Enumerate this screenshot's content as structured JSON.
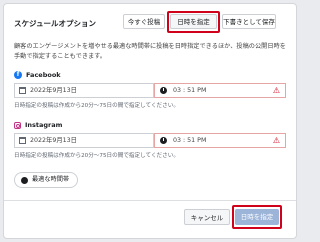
{
  "dialog": {
    "title": "スケジュールオプション",
    "tabs": [
      "今すぐ投稿",
      "日時を指定",
      "下書きとして保存"
    ],
    "description": "顧客のエンゲージメントを増やせる最適な時間帯に投稿を日時指定できるほか、投稿の公開日時を手動で指定することもできます。",
    "facebook": {
      "label": "Facebook",
      "date": "2022年9月13日",
      "time": "03 : 51 PM",
      "hint": "日時指定の投稿は作成から20分〜75日の間で指定してください。"
    },
    "instagram": {
      "label": "Instagram",
      "date": "2022年9月13日",
      "time": "03 : 51 PM",
      "hint": "日時指定の投稿は作成から20分〜75日の間で指定してください。"
    },
    "best_time_button": "最適な時間帯",
    "cancel": "キャンセル",
    "submit": "日時を指定"
  },
  "colors": {
    "highlight": "#d0021b",
    "facebook_blue": "#1877f2",
    "submit_disabled": "#9cb4d8"
  }
}
